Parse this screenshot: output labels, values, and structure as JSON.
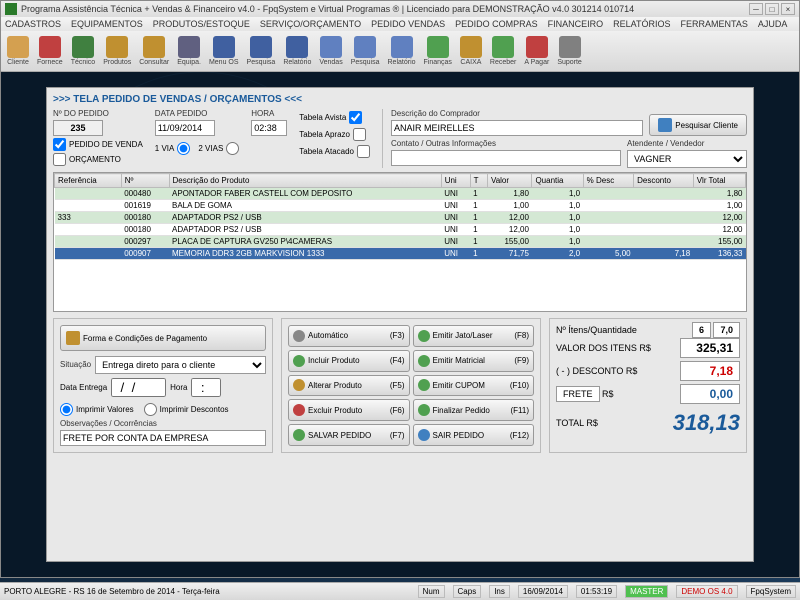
{
  "title": "Programa Assistência Técnica + Vendas & Financeiro v4.0 - FpqSystem e Virtual Programas ® | Licenciado para DEMONSTRAÇÃO v4.0 301214 010714",
  "menu": [
    "CADASTROS",
    "EQUIPAMENTOS",
    "PRODUTOS/ESTOQUE",
    "SERVIÇO/ORÇAMENTO",
    "PEDIDO VENDAS",
    "PEDIDO COMPRAS",
    "FINANCEIRO",
    "RELATÓRIOS",
    "FERRAMENTAS",
    "AJUDA"
  ],
  "toolbar": [
    {
      "label": "Cliente",
      "color": "#d4a050"
    },
    {
      "label": "Fornece",
      "color": "#c04040"
    },
    {
      "label": "Técnico",
      "color": "#408040"
    },
    {
      "label": "Produtos",
      "color": "#c09030"
    },
    {
      "label": "Consultar",
      "color": "#c09030"
    },
    {
      "label": "Equipa.",
      "color": "#606080"
    },
    {
      "label": "Menu OS",
      "color": "#4060a0"
    },
    {
      "label": "Pesquisa",
      "color": "#4060a0"
    },
    {
      "label": "Relatório",
      "color": "#4060a0"
    },
    {
      "label": "Vendas",
      "color": "#6080c0"
    },
    {
      "label": "Pesquisa",
      "color": "#6080c0"
    },
    {
      "label": "Relatório",
      "color": "#6080c0"
    },
    {
      "label": "Finanças",
      "color": "#50a050"
    },
    {
      "label": "CAIXA",
      "color": "#c09030"
    },
    {
      "label": "Receber",
      "color": "#50a050"
    },
    {
      "label": "A Pagar",
      "color": "#c04040"
    },
    {
      "label": "Suporte",
      "color": "#808080"
    }
  ],
  "header": ">>>   TELA PEDIDO DE VENDAS / ORÇAMENTOS   <<<",
  "order": {
    "num_label": "Nº DO PEDIDO",
    "num": "235",
    "date_label": "DATA PEDIDO",
    "date": "11/09/2014",
    "hour_label": "HORA",
    "hour": "02:38",
    "venda_chk": "PEDIDO DE VENDA",
    "orc_chk": "ORÇAMENTO",
    "via1": "1 VIA",
    "via2": "2 VIAS",
    "tavista": "Tabela Avista",
    "taprazo": "Tabela Aprazo",
    "tatacado": "Tabela Atacado",
    "desc_comp": "Descrição do Comprador",
    "buyer": "ANAIR MEIRELLES",
    "pesq_btn": "Pesquisar Cliente",
    "contato": "Contato / Outras Informações",
    "contato_val": "",
    "atend": "Atendente / Vendedor",
    "atend_val": "VAGNER"
  },
  "cols": [
    "Referência",
    "Nº",
    "Descrição do Produto",
    "Uni",
    "T",
    "Valor",
    "Quantia",
    "% Desc",
    "Desconto",
    "Vlr Total"
  ],
  "rows": [
    {
      "ref": "",
      "n": "000480",
      "desc": "APONTADOR FABER CASTELL COM DEPOSITO",
      "uni": "UNI",
      "t": "1",
      "val": "1,80",
      "q": "1,0",
      "pd": "",
      "d": "",
      "tot": "1,80",
      "cls": "alt"
    },
    {
      "ref": "",
      "n": "001619",
      "desc": "BALA DE GOMA",
      "uni": "UNI",
      "t": "1",
      "val": "1,00",
      "q": "1,0",
      "pd": "",
      "d": "",
      "tot": "1,00",
      "cls": ""
    },
    {
      "ref": "333",
      "n": "000180",
      "desc": "ADAPTADOR PS2 / USB",
      "uni": "UNI",
      "t": "1",
      "val": "12,00",
      "q": "1,0",
      "pd": "",
      "d": "",
      "tot": "12,00",
      "cls": "alt"
    },
    {
      "ref": "",
      "n": "000180",
      "desc": "ADAPTADOR PS2 / USB",
      "uni": "UNI",
      "t": "1",
      "val": "12,00",
      "q": "1,0",
      "pd": "",
      "d": "",
      "tot": "12,00",
      "cls": ""
    },
    {
      "ref": "",
      "n": "000297",
      "desc": "PLACA DE CAPTURA GV250 P\\4CAMERAS",
      "uni": "UNI",
      "t": "1",
      "val": "155,00",
      "q": "1,0",
      "pd": "",
      "d": "",
      "tot": "155,00",
      "cls": "alt"
    },
    {
      "ref": "",
      "n": "000907",
      "desc": "MEMORIA DDR3 2GB MARKVISION 1333",
      "uni": "UNI",
      "t": "1",
      "val": "71,75",
      "q": "2,0",
      "pd": "5,00",
      "d": "7,18",
      "tot": "136,33",
      "cls": "sel"
    }
  ],
  "pay_btn": "Forma e Condições de Pagamento",
  "situacao_lbl": "Situação",
  "situacao": "Entrega direto para o cliente",
  "entrega_lbl": "Data Entrega",
  "entrega": "  /  /    ",
  "entrega_h_lbl": "Hora",
  "entrega_h": "  :  ",
  "imp_val": "Imprimir Valores",
  "imp_desc": "Imprimir Descontos",
  "obs_lbl": "Observações / Ocorrências",
  "obs": "FRETE POR CONTA DA EMPRESA",
  "actions": [
    {
      "label": "Automático",
      "key": "(F3)",
      "color": "#888"
    },
    {
      "label": "Emitir Jato/Laser",
      "key": "(F8)",
      "color": "#50a050"
    },
    {
      "label": "Incluir Produto",
      "key": "(F4)",
      "color": "#50a050"
    },
    {
      "label": "Emitir Matricial",
      "key": "(F9)",
      "color": "#50a050"
    },
    {
      "label": "Alterar Produto",
      "key": "(F5)",
      "color": "#c09030"
    },
    {
      "label": "Emitir CUPOM",
      "key": "(F10)",
      "color": "#50a050"
    },
    {
      "label": "Excluir Produto",
      "key": "(F6)",
      "color": "#c04040"
    },
    {
      "label": "Finalizar Pedido",
      "key": "(F11)",
      "color": "#50a050"
    },
    {
      "label": "SALVAR PEDIDO",
      "key": "(F7)",
      "color": "#50a050"
    },
    {
      "label": "SAIR  PEDIDO",
      "key": "(F12)",
      "color": "#4080c0"
    }
  ],
  "totals": {
    "itens_lbl": "Nº Ítens/Quantidade",
    "itens": "6",
    "qtd": "7,0",
    "valor_lbl": "VALOR DOS ITENS R$",
    "valor": "325,31",
    "desc_lbl": "( - ) DESCONTO R$",
    "desc": "7,18",
    "frete_lbl": "FRETE",
    "frete_r": "R$",
    "frete": "0,00",
    "total_lbl": "TOTAL R$",
    "total": "318,13"
  },
  "status": {
    "loc": "PORTO ALEGRE - RS 16 de Setembro de 2014 - Terça-feira",
    "num": "Num",
    "caps": "Caps",
    "ins": "Ins",
    "date": "16/09/2014",
    "time": "01:53:19",
    "master": "MASTER",
    "demo": "DEMO OS 4.0",
    "fpq": "FpqSystem"
  }
}
